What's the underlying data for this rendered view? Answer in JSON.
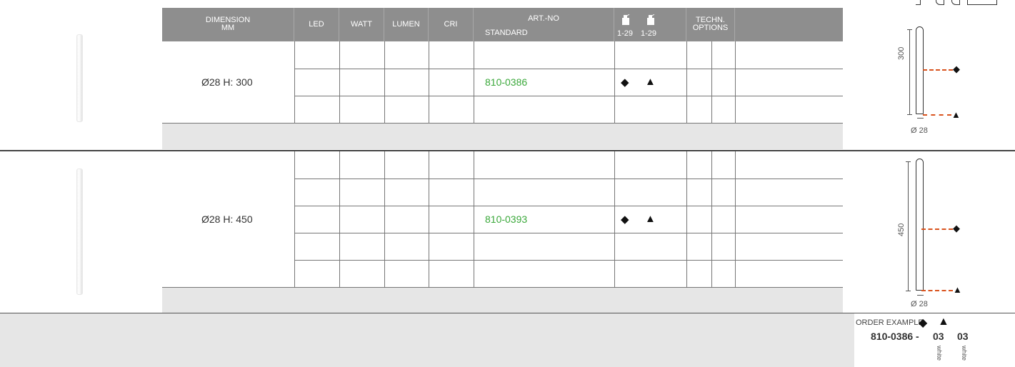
{
  "header": {
    "dimension": "DIMENSION",
    "dimension_unit": "MM",
    "led": "LED",
    "watt": "WATT",
    "lumen": "LUMEN",
    "cri": "CRI",
    "art_no": "ART.-NO",
    "standard": "STANDARD",
    "color_range_1": "1-29",
    "color_range_2": "1-29",
    "techn": "TECHN.",
    "options": "OPTIONS"
  },
  "products": [
    {
      "dimension": "Ø28 H: 300",
      "art_no": "810-0386",
      "diamond": "◆",
      "triangle": "▲",
      "drawing": {
        "height_label": "300",
        "diameter_label": "Ø 28"
      }
    },
    {
      "dimension": "Ø28 H: 450",
      "art_no": "810-0393",
      "diamond": "◆",
      "triangle": "▲",
      "drawing": {
        "height_label": "450",
        "diameter_label": "Ø 28"
      }
    }
  ],
  "order_example": {
    "label": "ORDER EXAMPLE:",
    "code": "810-0386 -",
    "num1": "03",
    "num2": "03",
    "color1": "white",
    "color2": "white",
    "diamond": "◆",
    "triangle": "▲"
  },
  "colors": {
    "header_bg": "#8e8e8e",
    "article_green": "#3aa83a",
    "dash_orange": "#d9531e",
    "grey_band": "#e6e6e6"
  }
}
